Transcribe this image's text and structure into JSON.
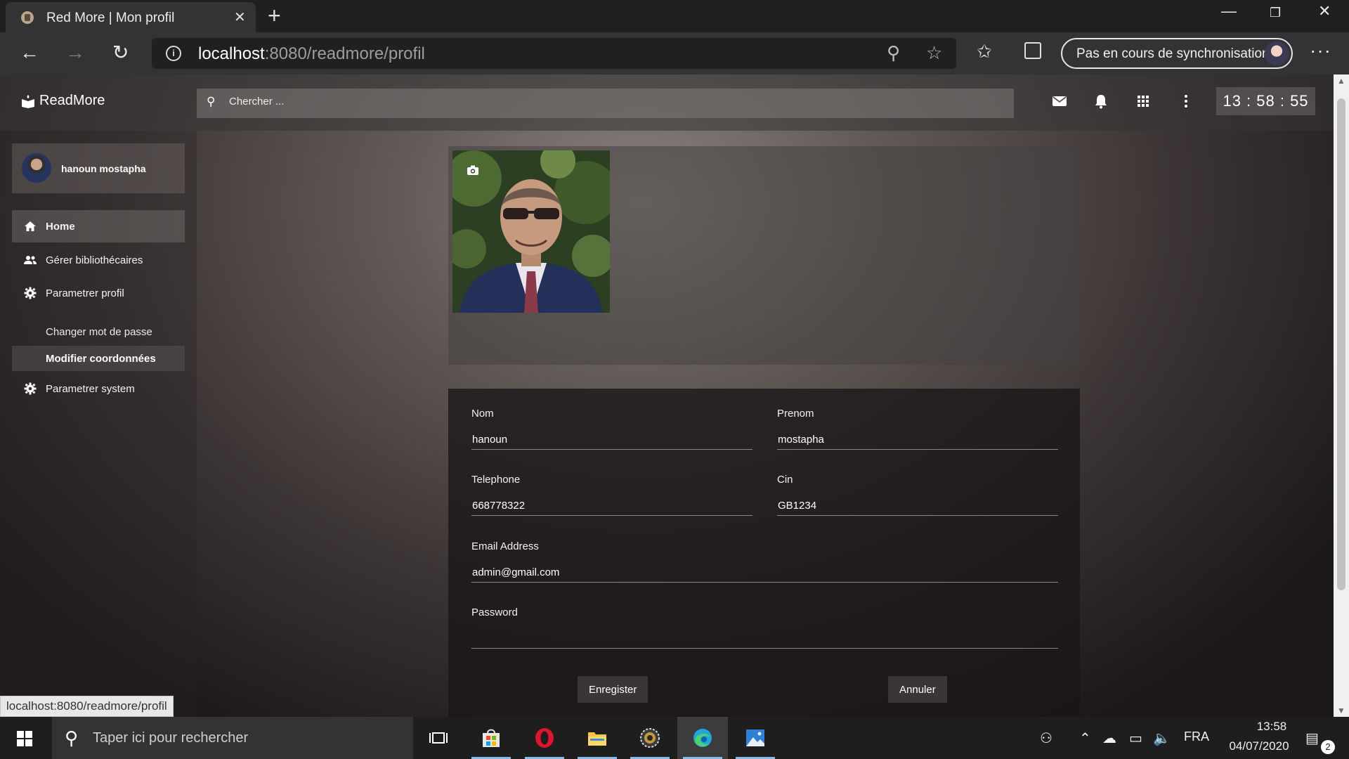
{
  "browser": {
    "tab_title": "Red More | Mon profil",
    "tab_close": "✕",
    "new_tab": "+",
    "url_host": "localhost",
    "url_path": ":8080/readmore/profil",
    "sync_label": "Pas en cours de synchronisation",
    "status_url": "localhost:8080/readmore/profil"
  },
  "app": {
    "brand": "ReadMore",
    "search_placeholder": "Chercher ...",
    "clock": "13 : 58 : 55"
  },
  "sidebar": {
    "user_name": "hanoun mostapha",
    "items": [
      {
        "label": "Home",
        "icon": "home-icon"
      },
      {
        "label": "Gérer bibliothécaires",
        "icon": "people-icon"
      },
      {
        "label": "Parametrer profil",
        "icon": "gear-icon"
      },
      {
        "label": "Parametrer system",
        "icon": "gear-icon"
      }
    ],
    "sub_items": [
      {
        "label": "Changer mot de passe"
      },
      {
        "label": "Modifier coordonnées"
      }
    ]
  },
  "form": {
    "nom": {
      "label": "Nom",
      "value": "hanoun"
    },
    "prenom": {
      "label": "Prenom",
      "value": "mostapha"
    },
    "telephone": {
      "label": "Telephone",
      "value": "668778322"
    },
    "cin": {
      "label": "Cin",
      "value": "GB1234"
    },
    "email": {
      "label": "Email Address",
      "value": "admin@gmail.com"
    },
    "password": {
      "label": "Password",
      "value": ""
    },
    "save_label": "Enregister",
    "cancel_label": "Annuler"
  },
  "taskbar": {
    "search_placeholder": "Taper ici pour rechercher",
    "language": "FRA",
    "time": "13:58",
    "date": "04/07/2020",
    "notification_count": "2"
  }
}
